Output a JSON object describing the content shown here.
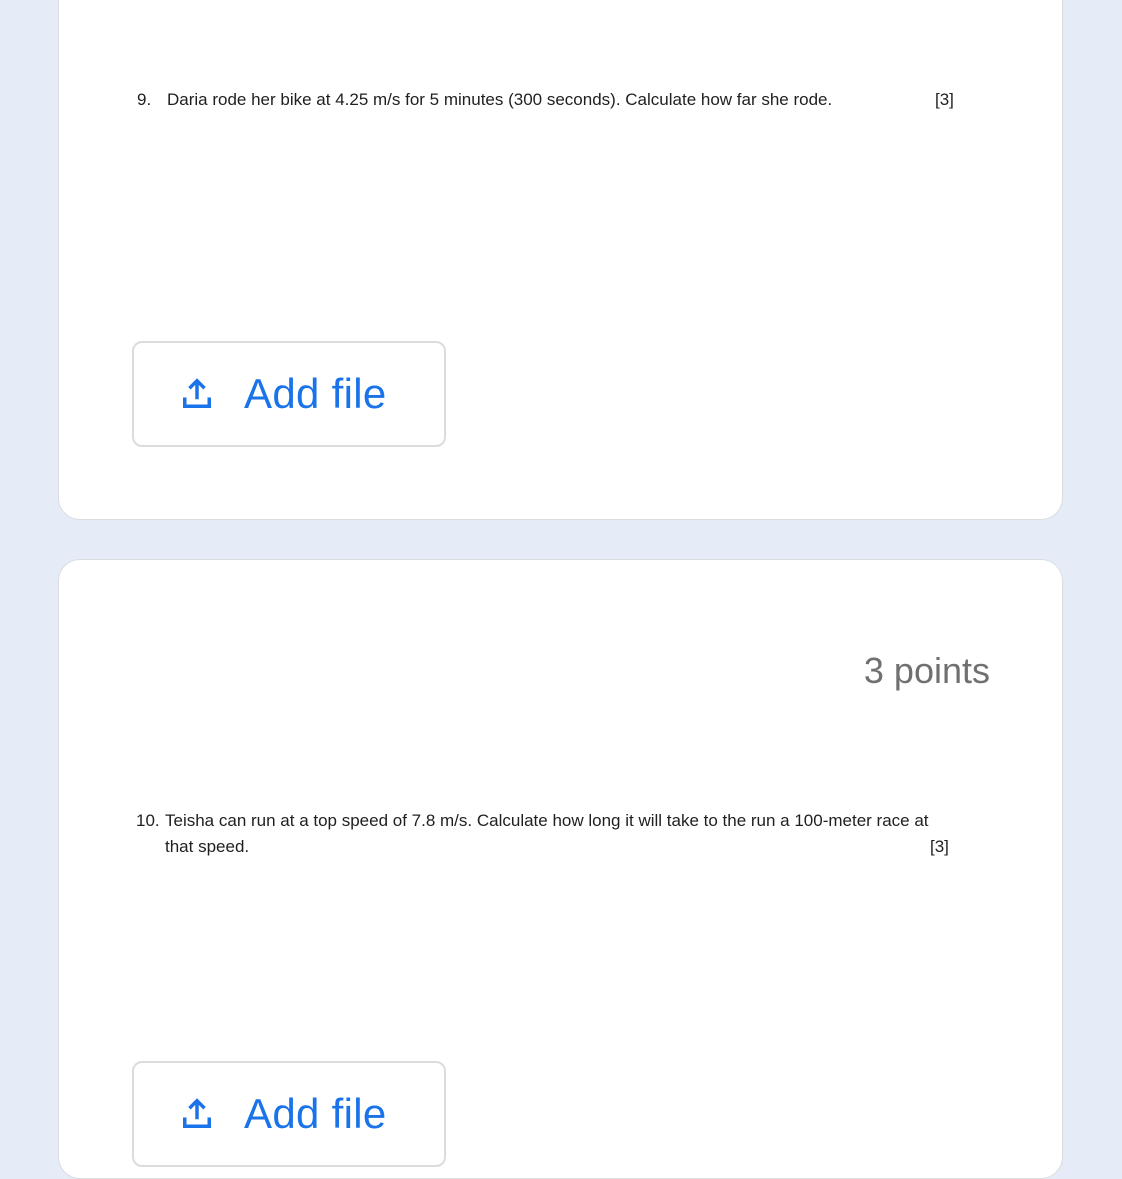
{
  "questions": [
    {
      "number": "9.",
      "text": "Daria rode her bike at 4.25 m/s for 5 minutes (300 seconds).  Calculate how far she rode.",
      "marks": "[3]",
      "add_file_label": "Add file"
    },
    {
      "points": "3 points",
      "number": "10.",
      "text_line1": "Teisha can run at a top speed of 7.8 m/s.  Calculate how long it will take to the run a 100-meter race at",
      "text_line2": "that speed.",
      "marks": "[3]",
      "add_file_label": "Add file"
    }
  ],
  "colors": {
    "background": "#e5ecf8",
    "accent": "#1a73e8",
    "points_text": "#707070"
  },
  "icons": {
    "upload": "upload-icon"
  }
}
